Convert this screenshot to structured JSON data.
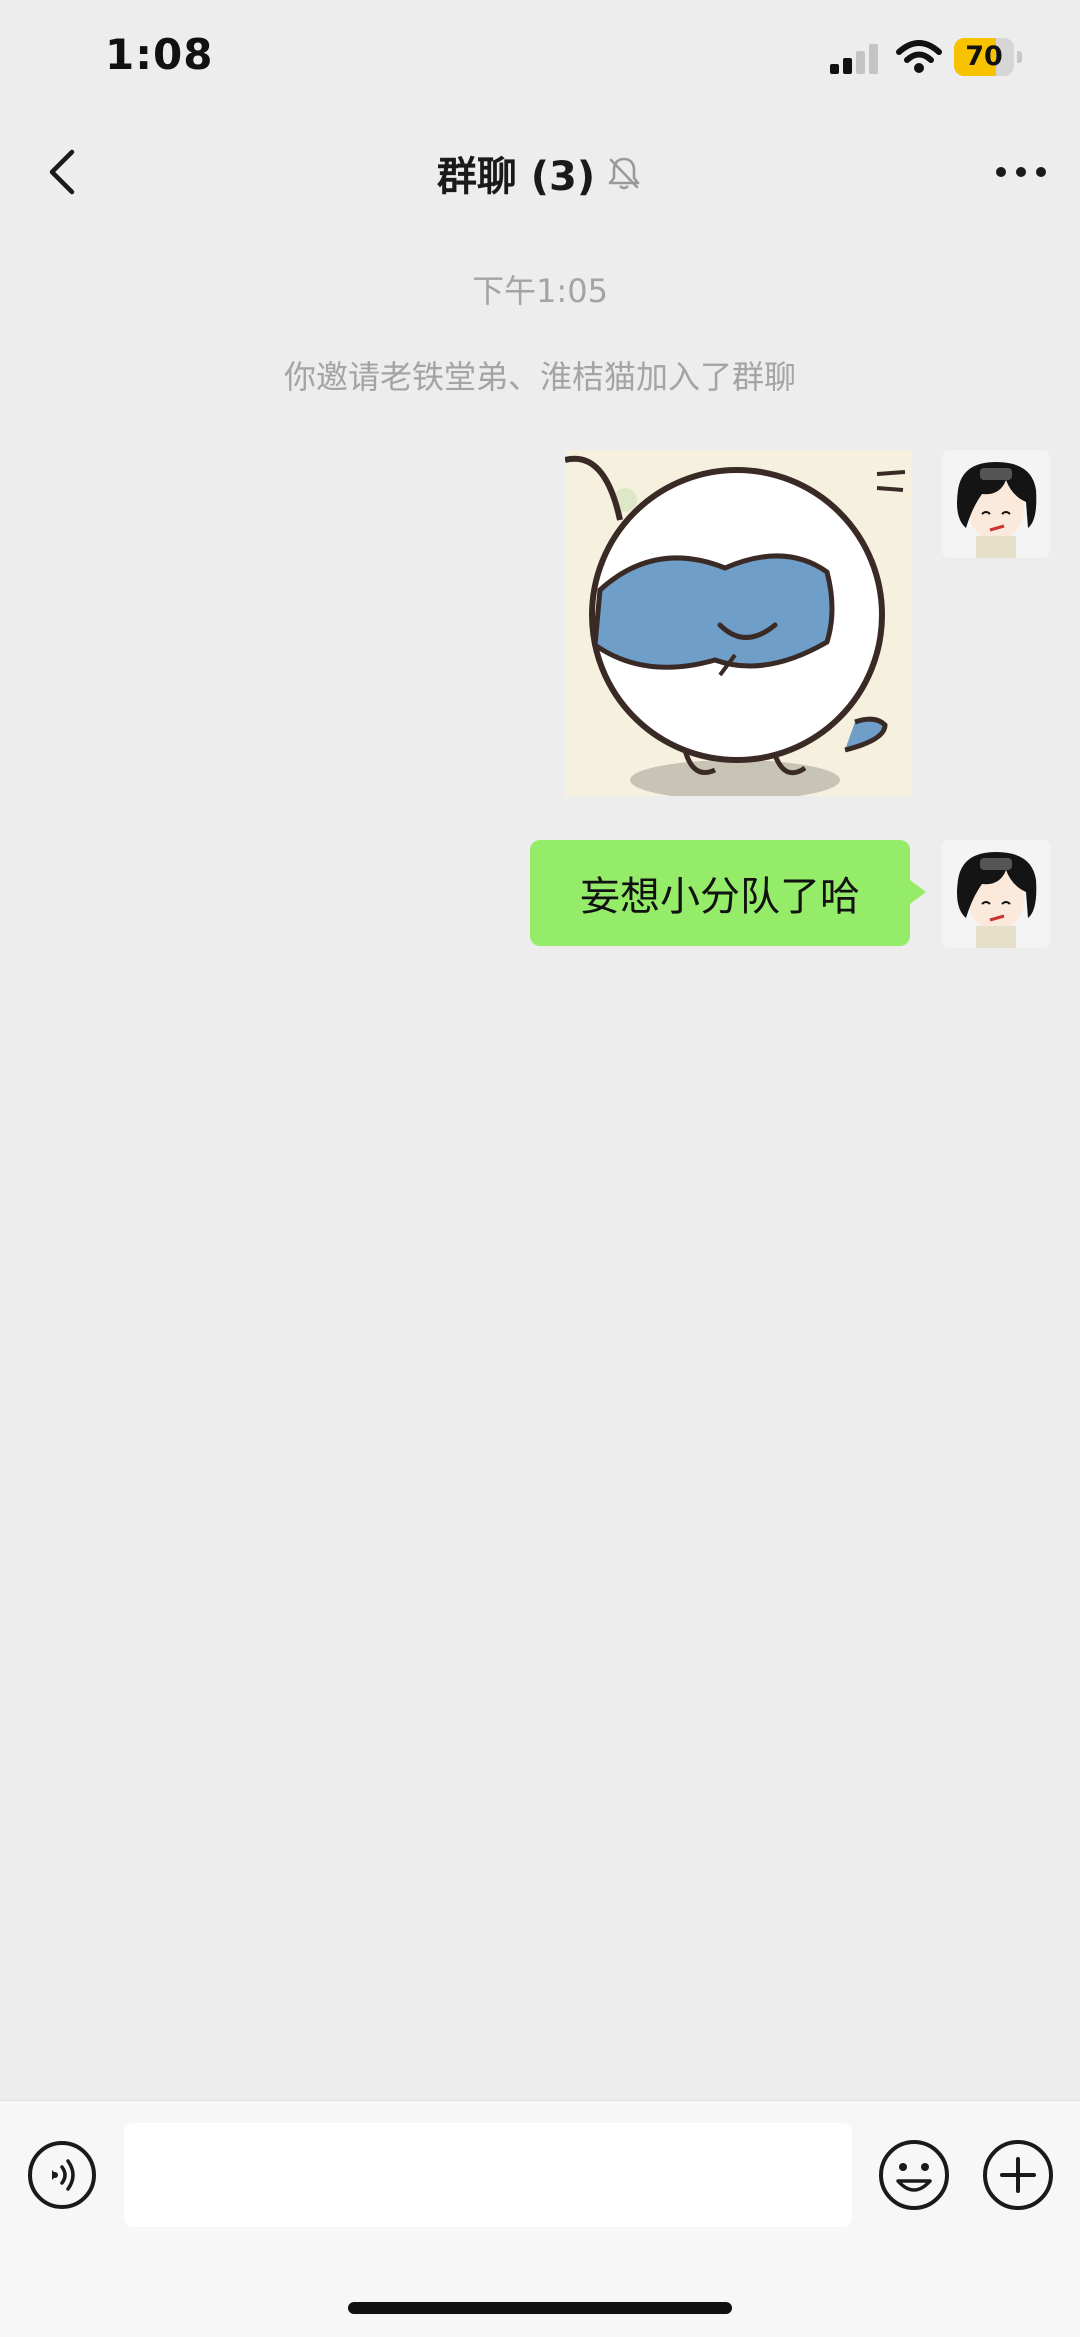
{
  "status_bar": {
    "time": "1:08",
    "battery_level": "70",
    "battery_fraction": 0.7,
    "battery_color": "#f7c300"
  },
  "nav": {
    "title": "群聊 (3)",
    "back_icon": "chevron-left-icon",
    "mute_icon": "bell-slash-icon",
    "more_icon": "ellipsis-icon"
  },
  "chat": {
    "timestamp": "下午1:05",
    "system_message": "你邀请老铁堂弟、淮桔猫加入了群聊",
    "messages": [
      {
        "type": "sticker",
        "sender": "self",
        "content": "sticker-image"
      },
      {
        "type": "text",
        "sender": "self",
        "text": "妄想小分队了哈"
      }
    ],
    "bubble_color": "#95ec69"
  },
  "input_bar": {
    "text_value": "",
    "voice_icon": "voice-icon",
    "emoji_icon": "emoji-icon",
    "plus_icon": "plus-icon"
  }
}
